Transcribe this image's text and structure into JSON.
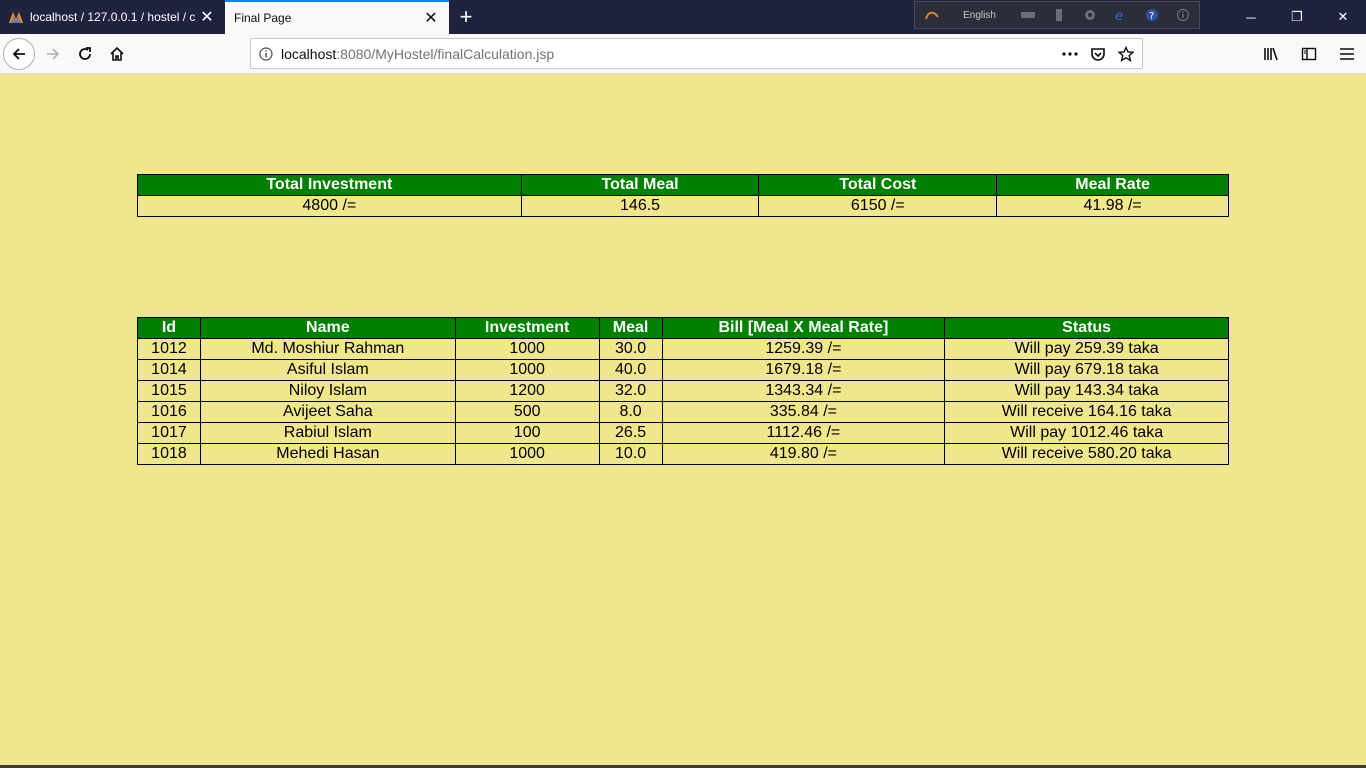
{
  "browser": {
    "tabs": [
      {
        "label": "localhost / 127.0.0.1 / hostel / c",
        "active": false
      },
      {
        "label": "Final Page",
        "active": true
      }
    ],
    "ime_language": "English",
    "url_host": "localhost",
    "url_rest": ":8080/MyHostel/finalCalculation.jsp"
  },
  "summary": {
    "headers": [
      "Total Investment",
      "Total Meal",
      "Total Cost",
      "Meal Rate"
    ],
    "values": [
      "4800 /=",
      "146.5",
      "6150 /=",
      "41.98 /="
    ]
  },
  "members": {
    "headers": [
      "Id",
      "Name",
      "Investment",
      "Meal",
      "Bill [Meal X Meal Rate]",
      "Status"
    ],
    "rows": [
      [
        "1012",
        "Md. Moshiur Rahman",
        "1000",
        "30.0",
        "1259.39 /=",
        "Will pay 259.39 taka"
      ],
      [
        "1014",
        "Asiful Islam",
        "1000",
        "40.0",
        "1679.18 /=",
        "Will pay 679.18 taka"
      ],
      [
        "1015",
        "Niloy Islam",
        "1200",
        "32.0",
        "1343.34 /=",
        "Will pay 143.34 taka"
      ],
      [
        "1016",
        "Avijeet Saha",
        "500",
        "8.0",
        "335.84 /=",
        "Will receive 164.16 taka"
      ],
      [
        "1017",
        "Rabiul Islam",
        "100",
        "26.5",
        "1112.46 /=",
        "Will pay 1012.46 taka"
      ],
      [
        "1018",
        "Mehedi Hasan",
        "1000",
        "10.0",
        "419.80 /=",
        "Will receive 580.20 taka"
      ]
    ]
  },
  "colors": {
    "page_background": "#f0e68c",
    "header_background": "#008000",
    "header_text": "#ffffff"
  }
}
